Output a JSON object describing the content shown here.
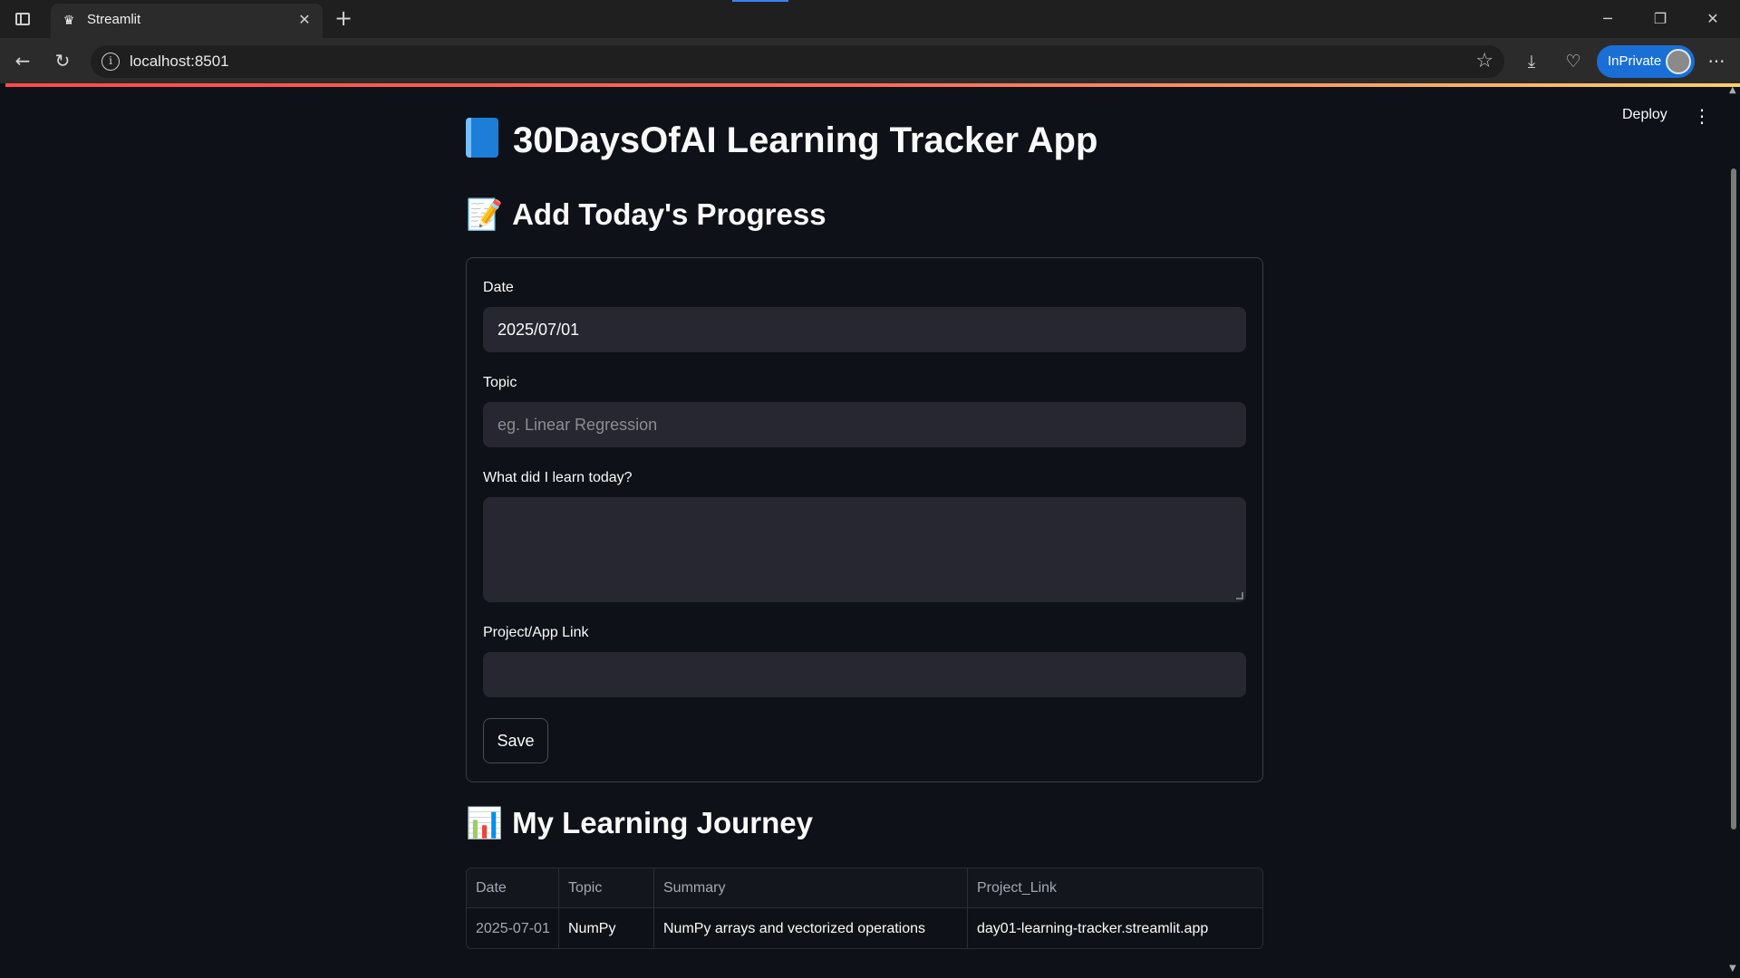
{
  "browser": {
    "tab_title": "Streamlit",
    "url": "localhost:8501",
    "inprivate_label": "InPrivate"
  },
  "app": {
    "header": {
      "deploy_label": "Deploy"
    },
    "title": "30DaysOfAI Learning Tracker App",
    "form_section": {
      "heading": "Add Today's Progress",
      "emoji": "📝",
      "date": {
        "label": "Date",
        "value": "2025/07/01"
      },
      "topic": {
        "label": "Topic",
        "placeholder": "eg. Linear Regression"
      },
      "learned": {
        "label": "What did I learn today?",
        "value": ""
      },
      "link": {
        "label": "Project/App Link",
        "value": ""
      },
      "save_label": "Save"
    },
    "journey_section": {
      "heading": "My Learning Journey",
      "emoji": "📊",
      "columns": [
        "Date",
        "Topic",
        "Summary",
        "Project_Link"
      ],
      "rows": [
        {
          "date": "2025-07-01",
          "topic": "NumPy",
          "summary": "NumPy arrays and vectorized operations",
          "project_link": "day01-learning-tracker.streamlit.app"
        }
      ]
    }
  },
  "icons": [
    "sidebar-toggle-icon",
    "streamlit-crown-icon",
    "close-icon",
    "plus-icon",
    "back-icon",
    "refresh-icon",
    "info-icon",
    "star-icon",
    "download-icon",
    "heartbeat-icon",
    "more-icon",
    "kebab-menu-icon",
    "book-icon"
  ]
}
